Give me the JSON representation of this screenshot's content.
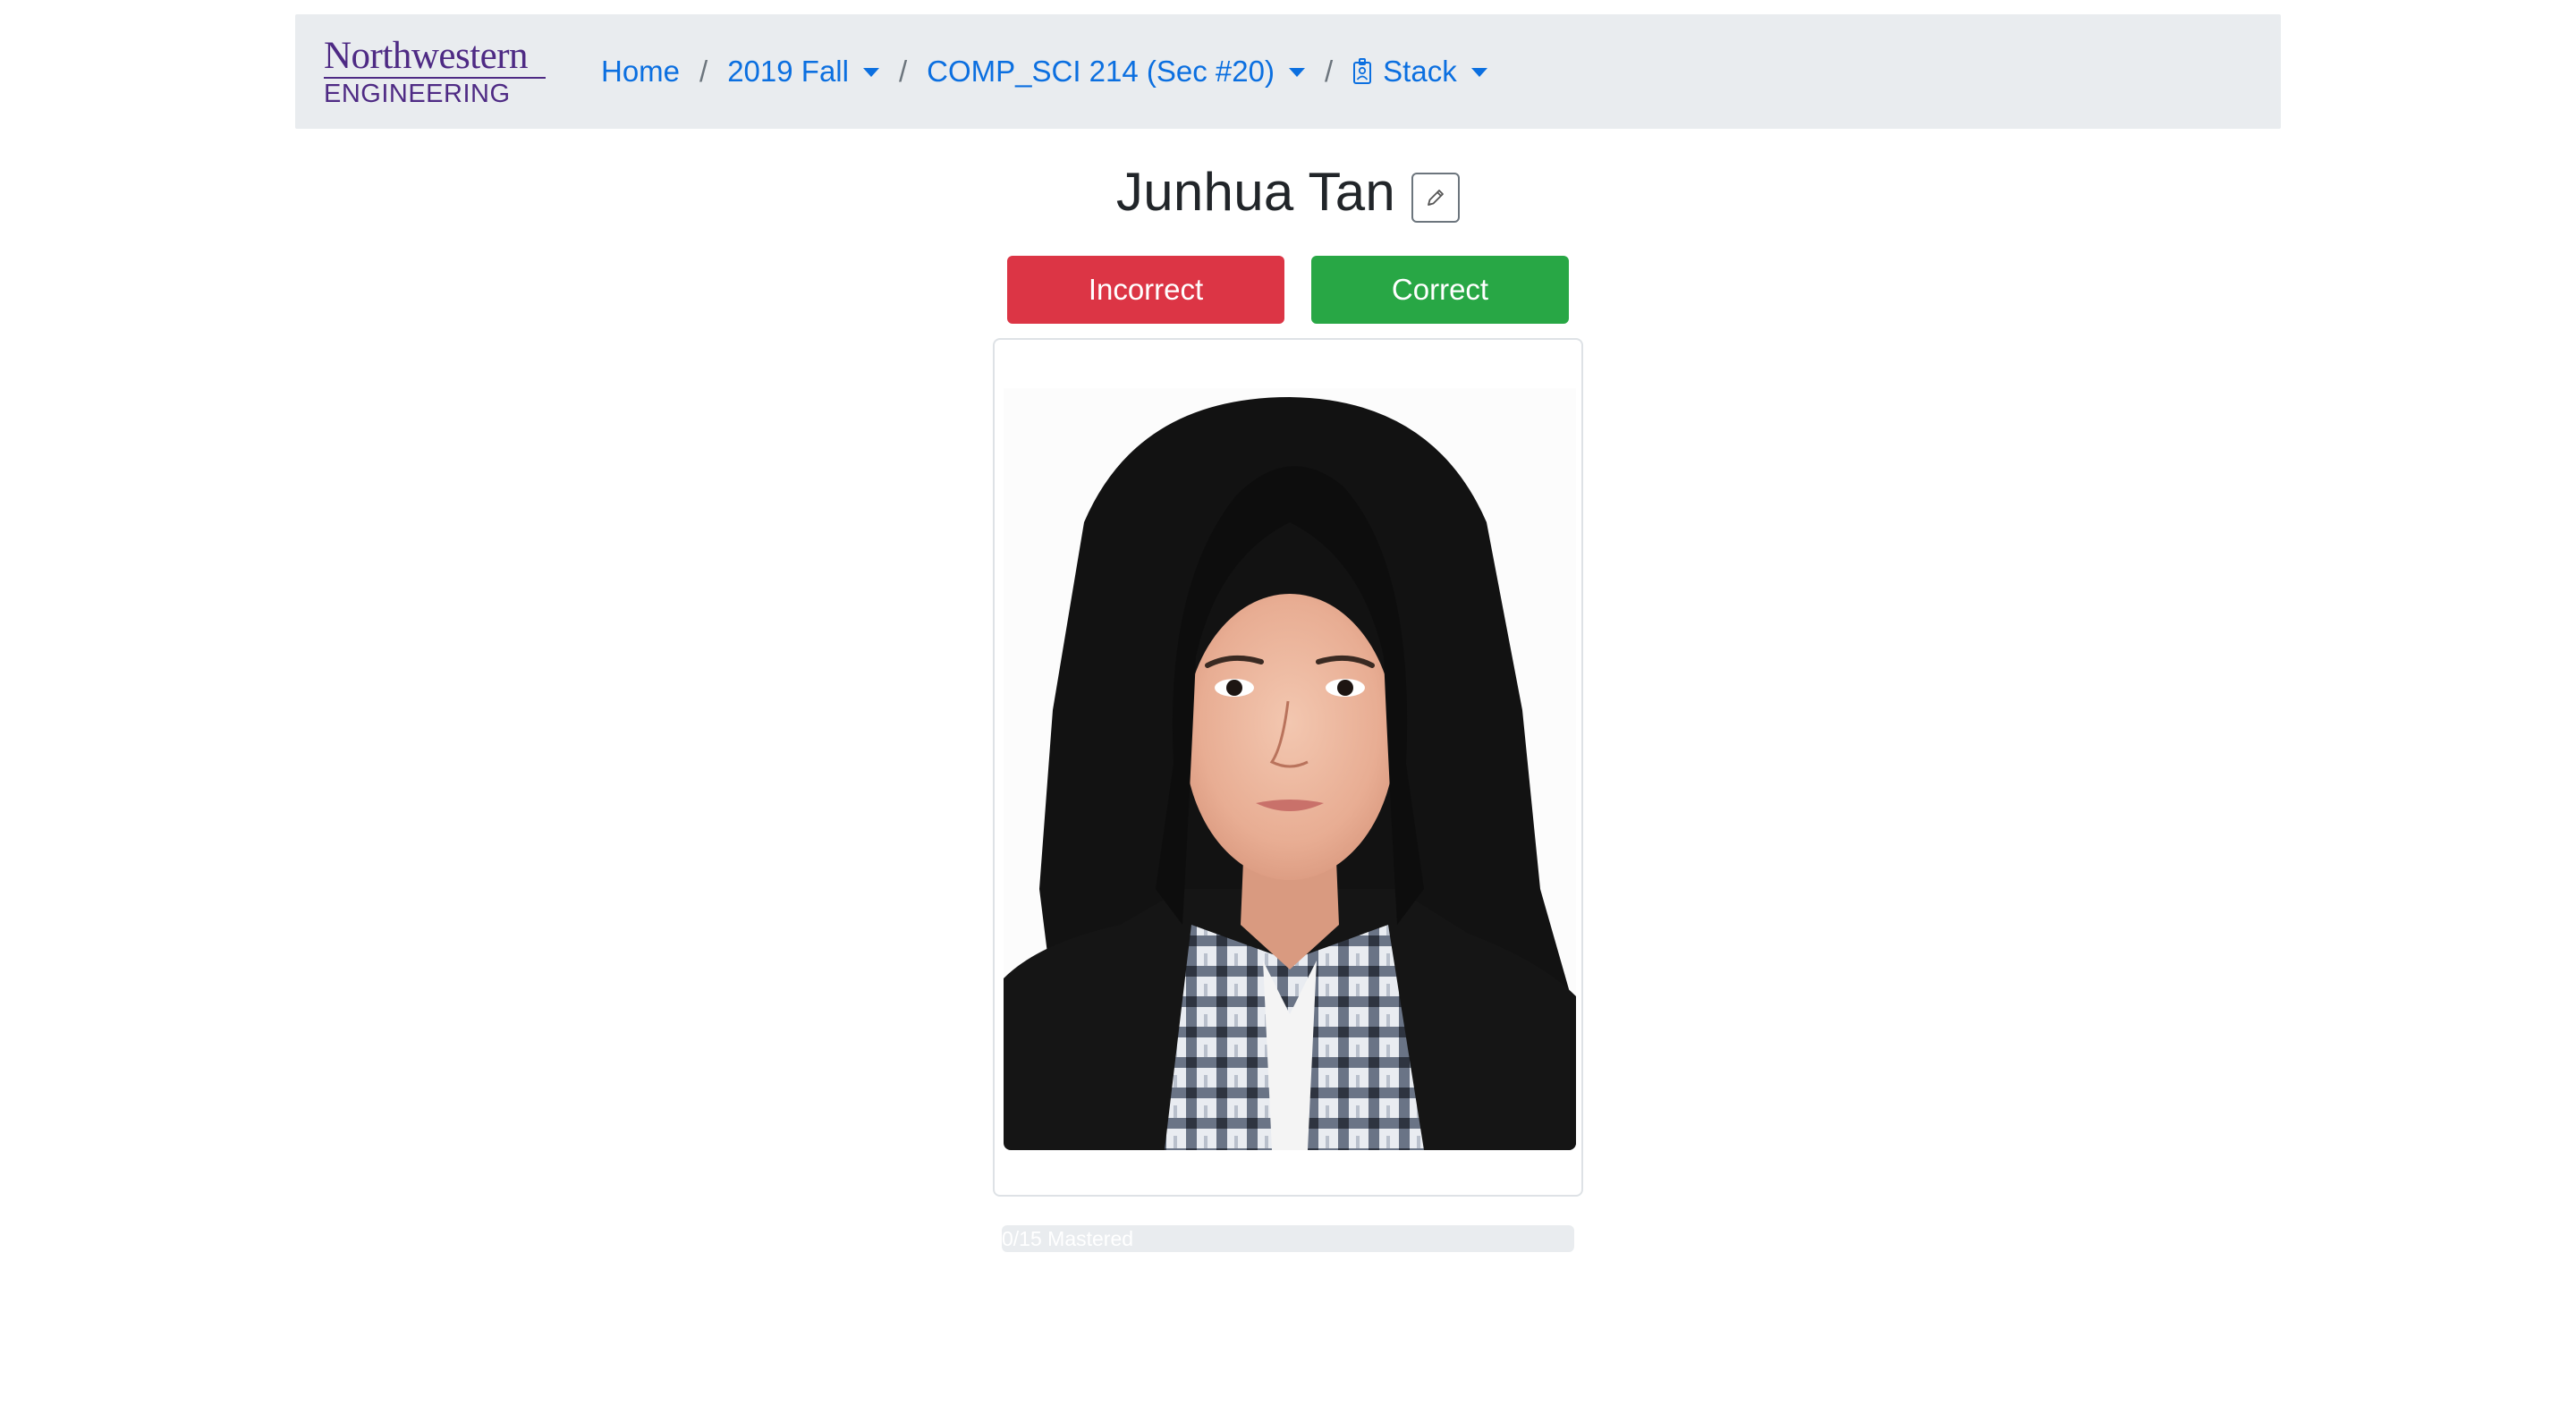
{
  "brand": {
    "line1": "Northwestern",
    "line2": "ENGINEERING",
    "color": "#4e2a84"
  },
  "breadcrumb": {
    "home": "Home",
    "term": "2019 Fall",
    "course": "COMP_SCI 214 (Sec #20)",
    "mode": "Stack",
    "mode_icon": "id-badge-icon"
  },
  "card": {
    "student_name": "Junhua Tan",
    "edit_icon": "pencil-icon"
  },
  "actions": {
    "incorrect_label": "Incorrect",
    "correct_label": "Correct",
    "incorrect_color": "#dc3545",
    "correct_color": "#28a745"
  },
  "progress": {
    "label": "0/15 Mastered",
    "mastered": 0,
    "total": 15
  },
  "colors": {
    "link": "#0b6fe0",
    "navbar_bg": "#e9ecef"
  }
}
